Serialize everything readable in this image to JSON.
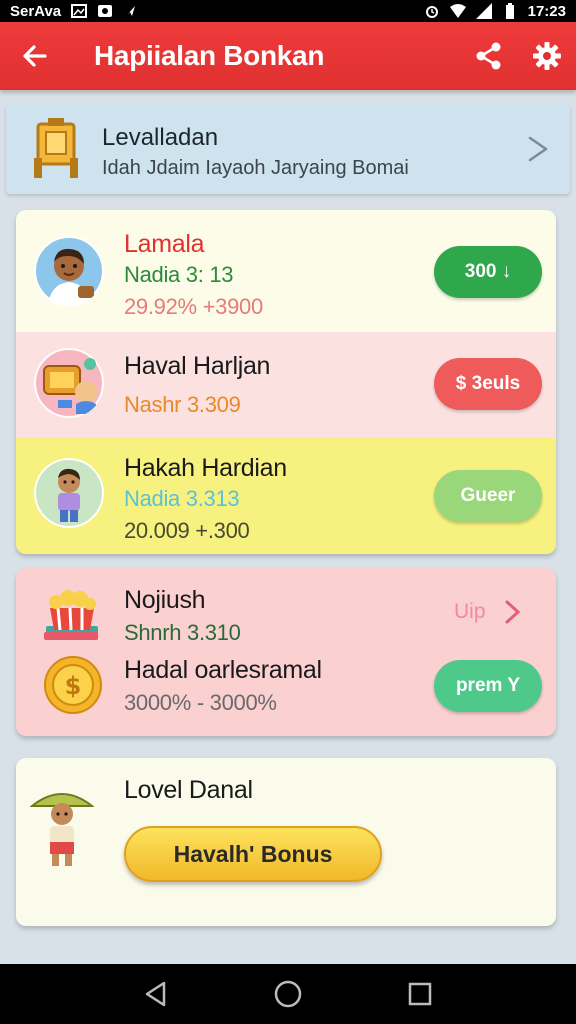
{
  "status_bar": {
    "carrier": "SerAva",
    "time": "17:23",
    "icons": [
      "image-icon",
      "photo-icon",
      "location-icon",
      "alarm-icon",
      "wifi-icon",
      "signal-icon",
      "battery-icon"
    ]
  },
  "app_bar": {
    "title": "Hapiialan Bonkan",
    "back_icon": "arrow-left-icon",
    "actions": [
      "share-icon",
      "gear-icon"
    ],
    "color": "#e53535"
  },
  "level_bar": {
    "title": "Levalladan",
    "subtitle": "Idah Jdaim Iayaoh Jaryaing Bomai",
    "icon": "signpost-icon"
  },
  "card_list": [
    {
      "name": "Lamala",
      "sub1": "Nadia 3: 13",
      "sub2": "29.92% +3900",
      "button": "300 ↓",
      "button_color": "#2ea84a",
      "bg": "#fcfce9"
    },
    {
      "name": "Haval Harljan",
      "sub1": "Nashr 3.309",
      "button": "$ 3euls",
      "button_color": "#ef5a5a",
      "bg": "#fce1e1"
    },
    {
      "name": "Hakah Hardian",
      "sub1": "Nadia 3.313",
      "sub2": "20.009 +.300",
      "button": "Gueer",
      "button_color": "#9ad77a",
      "bg": "#f7f280"
    }
  ],
  "rewards_card": {
    "item1": {
      "name": "Nojiush",
      "sub": "Shnrh 3.310",
      "link": "Uip"
    },
    "item2": {
      "name": "Hadal oarlesramal",
      "sub": "3000% - 3000%",
      "button": "prem Y",
      "button_color": "#4fc98a"
    }
  },
  "level_card": {
    "title": "Lovel Danal",
    "button": "Havalh' Bonus"
  },
  "nav_bar": [
    "back-nav-icon",
    "home-nav-icon",
    "recents-nav-icon"
  ]
}
